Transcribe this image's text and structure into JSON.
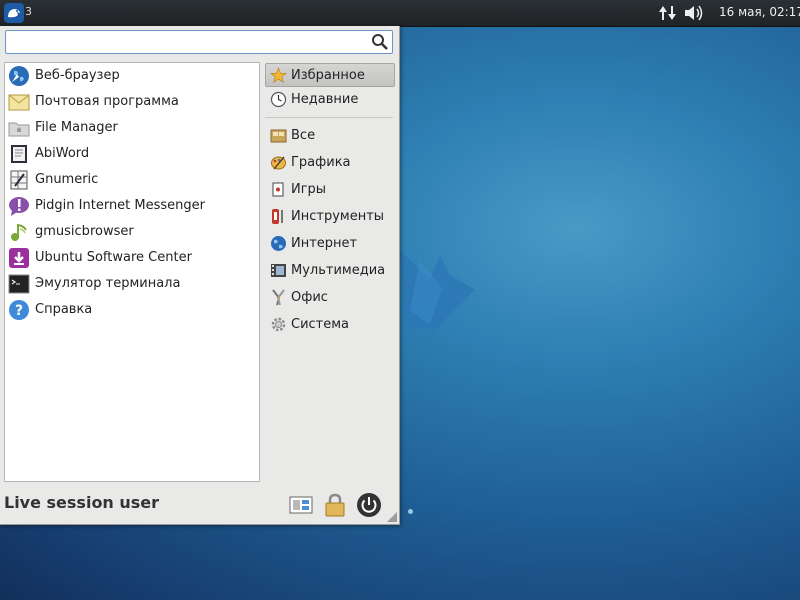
{
  "panel": {
    "workspace": "3",
    "clock": "16 мая, 02:17"
  },
  "search": {
    "value": "",
    "placeholder": ""
  },
  "apps": [
    {
      "label": "Веб-браузер",
      "icon": "globe-icon"
    },
    {
      "label": "Почтовая программа",
      "icon": "mail-icon"
    },
    {
      "label": "File Manager",
      "icon": "folder-icon"
    },
    {
      "label": "AbiWord",
      "icon": "document-icon"
    },
    {
      "label": "Gnumeric",
      "icon": "spreadsheet-icon"
    },
    {
      "label": "Pidgin Internet Messenger",
      "icon": "pidgin-icon"
    },
    {
      "label": "gmusicbrowser",
      "icon": "music-icon"
    },
    {
      "label": "Ubuntu Software Center",
      "icon": "software-center-icon"
    },
    {
      "label": "Эмулятор терминала",
      "icon": "terminal-icon"
    },
    {
      "label": "Справка",
      "icon": "help-icon"
    }
  ],
  "categories": {
    "favorites": "Избранное",
    "recent": "Недавние",
    "all": "Все",
    "graphics": "Графика",
    "games": "Игры",
    "tools": "Инструменты",
    "internet": "Интернет",
    "multimedia": "Мультимедиа",
    "office": "Офис",
    "system": "Система"
  },
  "footer": {
    "user": "Live session user"
  },
  "colors": {
    "accent": "#6c95c4",
    "selected": "#c9c9c7",
    "panel": "#25292c"
  }
}
